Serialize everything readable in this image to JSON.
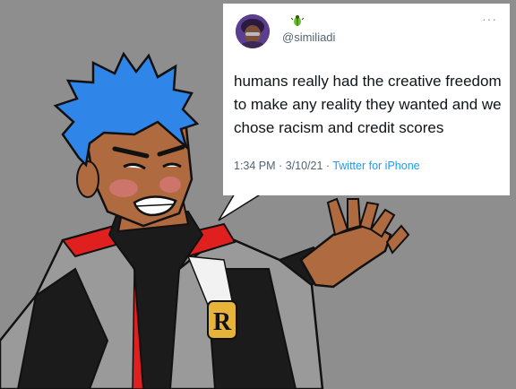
{
  "tweet": {
    "emoji_icon": "beetle-emoji",
    "handle": "@similiadi",
    "text": "humans really had the creative freedom to make any reality they wanted and we chose racism and credit scores",
    "time": "1:34 PM",
    "separator": "·",
    "date": "3/10/21",
    "source": "Twitter for iPhone"
  },
  "colors": {
    "background": "#8e8e8e",
    "hair": "#2f86e8",
    "skin": "#b06a3f",
    "coat_gray": "#9a9a9a",
    "coat_red": "#e0201e",
    "shirt": "#1b1b1b",
    "link": "#1d9bf0"
  },
  "badge": {
    "letter": "R"
  }
}
